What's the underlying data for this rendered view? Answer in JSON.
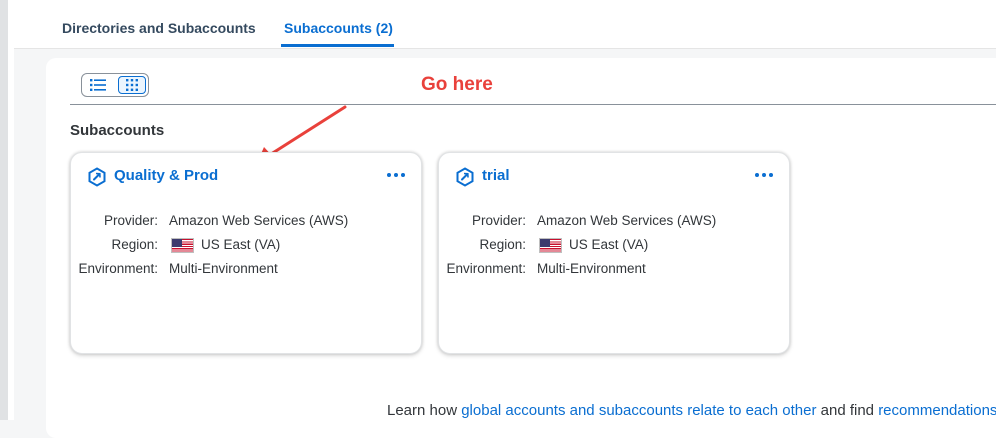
{
  "tabs": [
    {
      "label": "Directories and Subaccounts",
      "active": false
    },
    {
      "label": "Subaccounts (2)",
      "active": true
    }
  ],
  "view_toggle": {
    "options": [
      "list-view",
      "tile-view"
    ],
    "selected": "tile-view"
  },
  "annotation": {
    "text": "Go here",
    "color": "#e9413b"
  },
  "section": {
    "title": "Subaccounts"
  },
  "cards": [
    {
      "title": "Quality & Prod",
      "fields": [
        {
          "label": "Provider:",
          "value": "Amazon Web Services (AWS)"
        },
        {
          "label": "Region:",
          "value": "US East (VA)",
          "flag": "us-flag"
        },
        {
          "label": "Environment:",
          "value": "Multi-Environment"
        }
      ]
    },
    {
      "title": "trial",
      "fields": [
        {
          "label": "Provider:",
          "value": "Amazon Web Services (AWS)"
        },
        {
          "label": "Region:",
          "value": "US East (VA)",
          "flag": "us-flag"
        },
        {
          "label": "Environment:",
          "value": "Multi-Environment"
        }
      ]
    }
  ],
  "footer": {
    "prefix": "Learn how ",
    "link1": "global accounts and subaccounts relate to each other",
    "middle": " and find ",
    "link2": "recommendations"
  },
  "colors": {
    "accent": "#0a6ed1",
    "annotation": "#e9413b",
    "text": "#32363a"
  },
  "icons": [
    "list-icon",
    "grid-icon",
    "subaccount-icon",
    "more-icon",
    "us-flag-icon"
  ]
}
